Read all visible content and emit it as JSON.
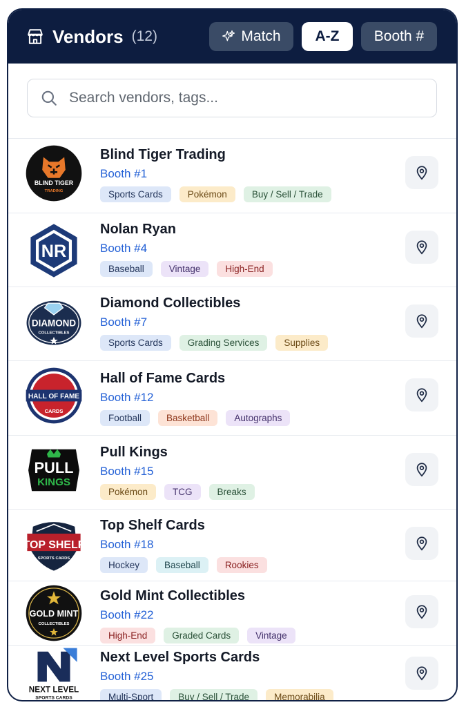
{
  "header": {
    "title": "Vendors",
    "count": "(12)",
    "buttons": {
      "match": "Match",
      "az": "A-Z",
      "booth": "Booth #"
    }
  },
  "search": {
    "placeholder": "Search vendors, tags..."
  },
  "tag_colors": {
    "blue": {
      "bg": "#dde7f8",
      "fg": "#22345a"
    },
    "orange": {
      "bg": "#fcebc9",
      "fg": "#6b4a16"
    },
    "green": {
      "bg": "#dff1e4",
      "fg": "#2a5138"
    },
    "purple": {
      "bg": "#ece3f8",
      "fg": "#43306b"
    },
    "red": {
      "bg": "#fbe0e0",
      "fg": "#8a2121"
    },
    "salmon": {
      "bg": "#fde3d6",
      "fg": "#8c3418"
    },
    "teal": {
      "bg": "#dcf1f5",
      "fg": "#22484f"
    }
  },
  "vendors": [
    {
      "name": "Blind Tiger Trading",
      "booth": "Booth #1",
      "tags": [
        {
          "label": "Sports Cards",
          "color": "blue"
        },
        {
          "label": "Pokémon",
          "color": "orange"
        },
        {
          "label": "Buy / Sell / Trade",
          "color": "green"
        }
      ],
      "logo": {
        "type": "circle",
        "bg": "#111111",
        "line1": "BLIND TIGER",
        "line2": "TRADING"
      }
    },
    {
      "name": "Nolan Ryan",
      "booth": "Booth #4",
      "tags": [
        {
          "label": "Baseball",
          "color": "blue"
        },
        {
          "label": "Vintage",
          "color": "purple"
        },
        {
          "label": "High-End",
          "color": "red"
        }
      ],
      "logo": {
        "type": "hexagon",
        "line1": "NR"
      }
    },
    {
      "name": "Diamond Collectibles",
      "booth": "Booth #7",
      "tags": [
        {
          "label": "Sports Cards",
          "color": "blue"
        },
        {
          "label": "Grading Services",
          "color": "green"
        },
        {
          "label": "Supplies",
          "color": "orange"
        }
      ],
      "logo": {
        "type": "badge",
        "line1": "DIAMOND",
        "line2": "COLLECTIBLES"
      }
    },
    {
      "name": "Hall of Fame Cards",
      "booth": "Booth #12",
      "tags": [
        {
          "label": "Football",
          "color": "blue"
        },
        {
          "label": "Basketball",
          "color": "salmon"
        },
        {
          "label": "Autographs",
          "color": "purple"
        }
      ],
      "logo": {
        "type": "hof",
        "line1": "HALL OF FAME",
        "line2": "CARDS"
      }
    },
    {
      "name": "Pull Kings",
      "booth": "Booth #15",
      "tags": [
        {
          "label": "Pokémon",
          "color": "orange"
        },
        {
          "label": "TCG",
          "color": "purple"
        },
        {
          "label": "Breaks",
          "color": "green"
        }
      ],
      "logo": {
        "type": "pull",
        "line1": "PULL",
        "line2": "KINGS"
      }
    },
    {
      "name": "Top Shelf Cards",
      "booth": "Booth #18",
      "tags": [
        {
          "label": "Hockey",
          "color": "blue"
        },
        {
          "label": "Baseball",
          "color": "teal"
        },
        {
          "label": "Rookies",
          "color": "red"
        }
      ],
      "logo": {
        "type": "shield",
        "line1": "TOP SHELF",
        "line2": "SPORTS CARDS"
      }
    },
    {
      "name": "Gold Mint Collectibles",
      "booth": "Booth #22",
      "tags": [
        {
          "label": "High-End",
          "color": "red"
        },
        {
          "label": "Graded Cards",
          "color": "green"
        },
        {
          "label": "Vintage",
          "color": "purple"
        }
      ],
      "logo": {
        "type": "goldmint",
        "line1": "GOLD MINT",
        "line2": "COLLECTIBLES"
      }
    },
    {
      "name": "Next Level Sports Cards",
      "booth": "Booth #25",
      "tags": [
        {
          "label": "Multi-Sport",
          "color": "blue"
        },
        {
          "label": "Buy / Sell / Trade",
          "color": "green"
        },
        {
          "label": "Memorabilia",
          "color": "orange"
        }
      ],
      "logo": {
        "type": "nextlevel",
        "line1": "NEXT LEVEL",
        "line2": "SPORTS CARDS"
      }
    }
  ]
}
